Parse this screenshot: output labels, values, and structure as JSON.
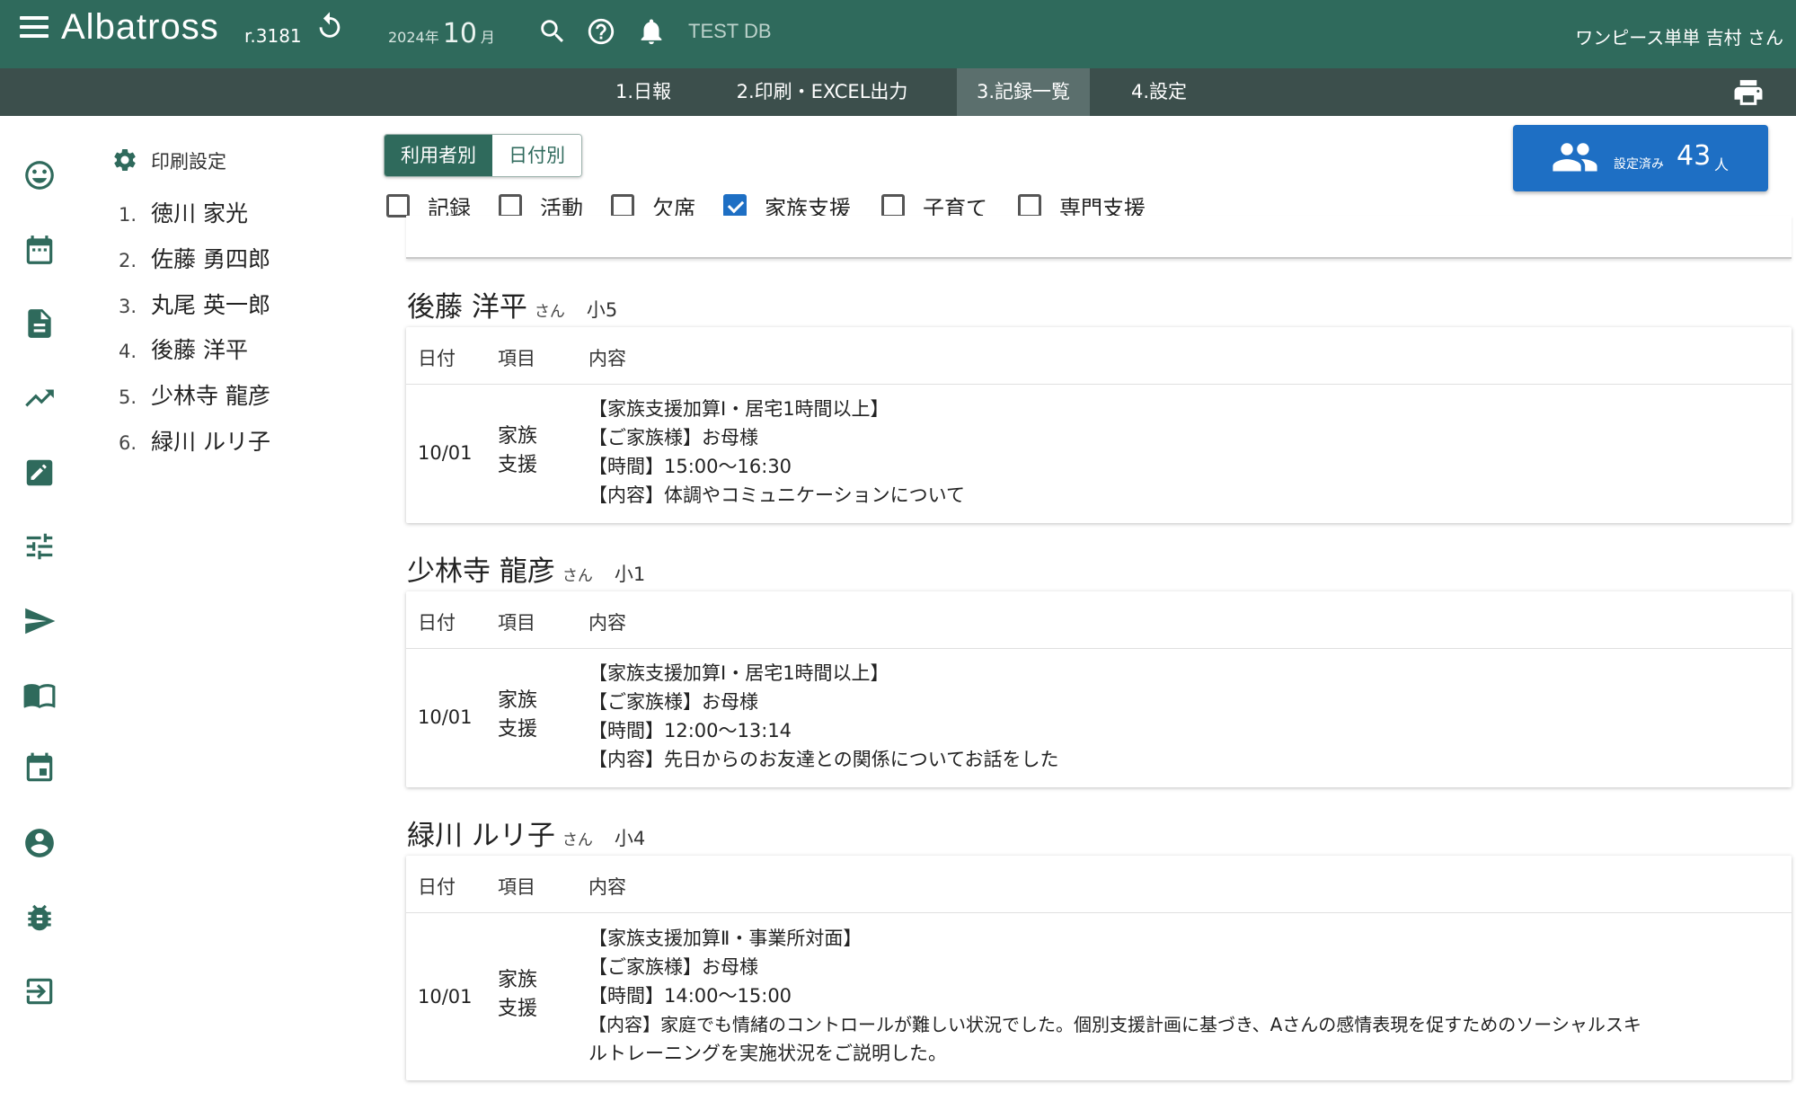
{
  "header": {
    "app_name": "Albatross",
    "version": "r.3181",
    "period": {
      "year": "2024年",
      "month": "10",
      "month_unit": "月"
    },
    "db_name": "TEST DB",
    "user": "ワンピース単単 吉村 さん"
  },
  "tabs": [
    {
      "label": "1.日報"
    },
    {
      "label": "2.印刷・EXCEL出力"
    },
    {
      "label": "3.記録一覧"
    },
    {
      "label": "4.設定"
    }
  ],
  "active_tab": "3.記録一覧",
  "sidebar_icons": [
    "smile-icon",
    "calendar-icon",
    "document-icon",
    "trending-icon",
    "edit-icon",
    "tune-icon",
    "send-icon",
    "book-icon",
    "event-icon",
    "account-icon",
    "bug-icon",
    "logout-icon"
  ],
  "print_settings": {
    "title": "印刷設定",
    "users": [
      {
        "num": "1.",
        "name": "徳川 家光"
      },
      {
        "num": "2.",
        "name": "佐藤 勇四郎"
      },
      {
        "num": "3.",
        "name": "丸尾 英一郎"
      },
      {
        "num": "4.",
        "name": "後藤 洋平"
      },
      {
        "num": "5.",
        "name": "少林寺 龍彦"
      },
      {
        "num": "6.",
        "name": "緑川 ルリ子"
      }
    ]
  },
  "view_toggle": {
    "by_user": "利用者別",
    "by_date": "日付別",
    "selected": "利用者別"
  },
  "filters": [
    {
      "label": "記録",
      "checked": false
    },
    {
      "label": "活動",
      "checked": false
    },
    {
      "label": "欠席",
      "checked": false
    },
    {
      "label": "家族支援",
      "checked": true
    },
    {
      "label": "子育て",
      "checked": false
    },
    {
      "label": "専門支援",
      "checked": false
    }
  ],
  "count_button": {
    "caption": "設定済み",
    "count": "43",
    "unit": "人"
  },
  "table_headers": {
    "date": "日付",
    "item": "項目",
    "content": "内容"
  },
  "records": [
    {
      "name": "後藤 洋平",
      "honorific": "さん",
      "grade": "小5",
      "date": "10/01",
      "item_line1": "家族",
      "item_line2": "支援",
      "lines": [
        "【家族支援加算Ⅰ・居宅1時間以上】",
        "【ご家族様】お母様",
        "【時間】15:00〜16:30",
        "【内容】体調やコミュニケーションについて"
      ]
    },
    {
      "name": "少林寺 龍彦",
      "honorific": "さん",
      "grade": "小1",
      "date": "10/01",
      "item_line1": "家族",
      "item_line2": "支援",
      "lines": [
        "【家族支援加算Ⅰ・居宅1時間以上】",
        "【ご家族様】お母様",
        "【時間】12:00〜13:14",
        "【内容】先日からのお友達との関係についてお話をした"
      ]
    },
    {
      "name": "緑川 ルリ子",
      "honorific": "さん",
      "grade": "小4",
      "date": "10/01",
      "item_line1": "家族",
      "item_line2": "支援",
      "lines": [
        "【家族支援加算Ⅱ・事業所対面】",
        "【ご家族様】お母様",
        "【時間】14:00〜15:00",
        "【内容】家庭でも情緒のコントロールが難しい状況でした。個別支援計画に基づき、Aさんの感情表現を促すためのソーシャルスキ",
        "ルトレーニングを実施状況をご説明した。"
      ]
    }
  ],
  "colors": {
    "primary": "#2f6a5c",
    "tabbar": "#3c4f4c",
    "accent": "#1e6fc4"
  }
}
